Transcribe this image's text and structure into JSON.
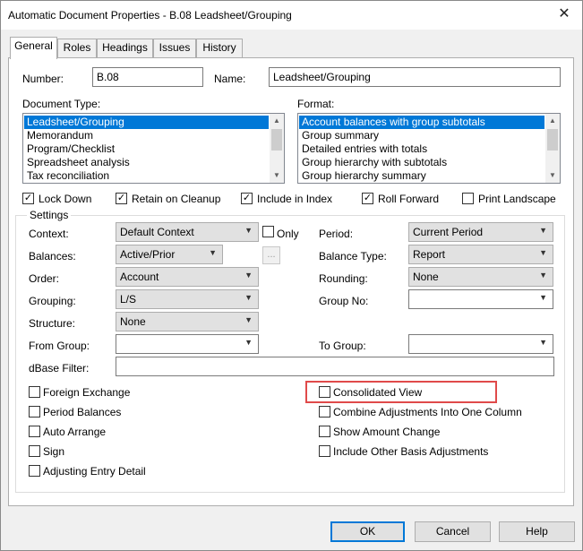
{
  "window": {
    "title": "Automatic Document Properties - B.08 Leadsheet/Grouping",
    "close_glyph": "✕"
  },
  "tabs": [
    "General",
    "Roles",
    "Headings",
    "Issues",
    "History"
  ],
  "number": {
    "label": "Number:",
    "value": "B.08"
  },
  "name": {
    "label": "Name:",
    "value": "Leadsheet/Grouping"
  },
  "document_type": {
    "label": "Document Type:",
    "items": [
      "Leadsheet/Grouping",
      "Memorandum",
      "Program/Checklist",
      "Spreadsheet analysis",
      "Tax reconciliation"
    ],
    "selected": 0
  },
  "format": {
    "label": "Format:",
    "items": [
      "Account balances with group subtotals",
      "Group summary",
      "Detailed entries with totals",
      "Group hierarchy with subtotals",
      "Group hierarchy summary"
    ],
    "selected": 0
  },
  "options": [
    {
      "label": "Lock Down",
      "checked": true
    },
    {
      "label": "Retain on Cleanup",
      "checked": true
    },
    {
      "label": "Include in Index",
      "checked": true
    },
    {
      "label": "Roll Forward",
      "checked": true
    },
    {
      "label": "Print Landscape",
      "checked": false
    }
  ],
  "settings": {
    "title": "Settings",
    "context": {
      "label": "Context:",
      "value": "Default Context"
    },
    "only": {
      "label": "Only",
      "checked": false
    },
    "period": {
      "label": "Period:",
      "value": "Current Period"
    },
    "balances": {
      "label": "Balances:",
      "value": "Active/Prior"
    },
    "ellipsis": "...",
    "balance_type": {
      "label": "Balance Type:",
      "value": "Report"
    },
    "order": {
      "label": "Order:",
      "value": "Account"
    },
    "rounding": {
      "label": "Rounding:",
      "value": "None"
    },
    "grouping": {
      "label": "Grouping:",
      "value": "L/S"
    },
    "group_no": {
      "label": "Group No:",
      "value": ""
    },
    "structure": {
      "label": "Structure:",
      "value": "None"
    },
    "from_group": {
      "label": "From Group:",
      "value": ""
    },
    "to_group": {
      "label": "To Group:",
      "value": ""
    },
    "dbase_filter": {
      "label": "dBase Filter:",
      "value": ""
    },
    "left_checks": [
      {
        "label": "Foreign Exchange",
        "checked": false
      },
      {
        "label": "Period Balances",
        "checked": false
      },
      {
        "label": "Auto Arrange",
        "checked": false
      },
      {
        "label": "Sign",
        "checked": false
      },
      {
        "label": "Adjusting Entry Detail",
        "checked": false
      }
    ],
    "right_checks": [
      {
        "label": "Consolidated View",
        "checked": false
      },
      {
        "label": "Combine Adjustments Into One Column",
        "checked": false
      },
      {
        "label": "Show Amount Change",
        "checked": false
      },
      {
        "label": "Include Other Basis Adjustments",
        "checked": false
      }
    ]
  },
  "buttons": {
    "ok": "OK",
    "cancel": "Cancel",
    "help": "Help"
  },
  "colors": {
    "selection": "#0078d7",
    "highlight_box": "#e04a4a"
  }
}
